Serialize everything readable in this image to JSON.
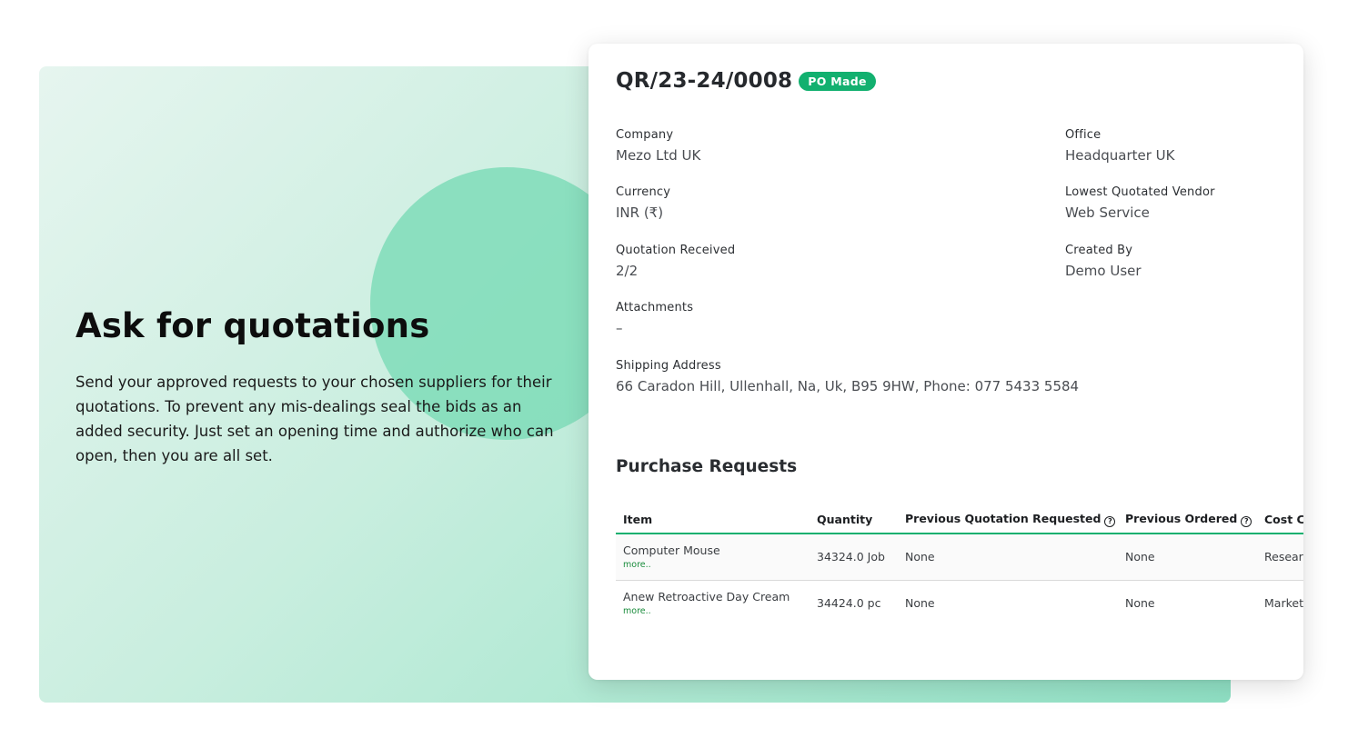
{
  "hero": {
    "title": "Ask for quotations",
    "description": "Send your approved requests to your chosen suppliers for their quotations. To prevent any mis-dealings seal the bids as an added security. Just set an opening time and authorize who can open, then you are all set."
  },
  "quotation": {
    "id": "QR/23-24/0008",
    "status": "PO Made",
    "status_color": "#12b06f",
    "fields": {
      "company": {
        "label": "Company",
        "value": "Mezo Ltd UK"
      },
      "office": {
        "label": "Office",
        "value": "Headquarter UK"
      },
      "currency": {
        "label": "Currency",
        "value": "INR (₹)"
      },
      "lowest_vendor": {
        "label": "Lowest Quotated Vendor",
        "value": "Web Service"
      },
      "quotation_received": {
        "label": "Quotation Received",
        "value": "2/2"
      },
      "created_by": {
        "label": "Created By",
        "value": "Demo User"
      },
      "attachments": {
        "label": "Attachments",
        "value": "–"
      },
      "shipping_address": {
        "label": "Shipping Address",
        "value": "66 Caradon Hill, Ullenhall, Na, Uk, B95 9HW, Phone: 077 5433 5584"
      }
    }
  },
  "purchase_requests": {
    "title": "Purchase Requests",
    "columns": [
      "Item",
      "Quantity",
      "Previous Quotation Requested",
      "Previous Ordered",
      "Cost Center"
    ],
    "more_label": "more..",
    "rows": [
      {
        "item": "Computer Mouse",
        "quantity": "34324.0 Job",
        "prev_quotation": "None",
        "prev_ordered": "None",
        "cost_center": "Research"
      },
      {
        "item": "Anew Retroactive Day Cream",
        "quantity": "34424.0 pc",
        "prev_quotation": "None",
        "prev_ordered": "None",
        "cost_center": "Marketing"
      }
    ]
  },
  "icons": {
    "help": "question-circle-icon",
    "help_glyph": "?"
  }
}
